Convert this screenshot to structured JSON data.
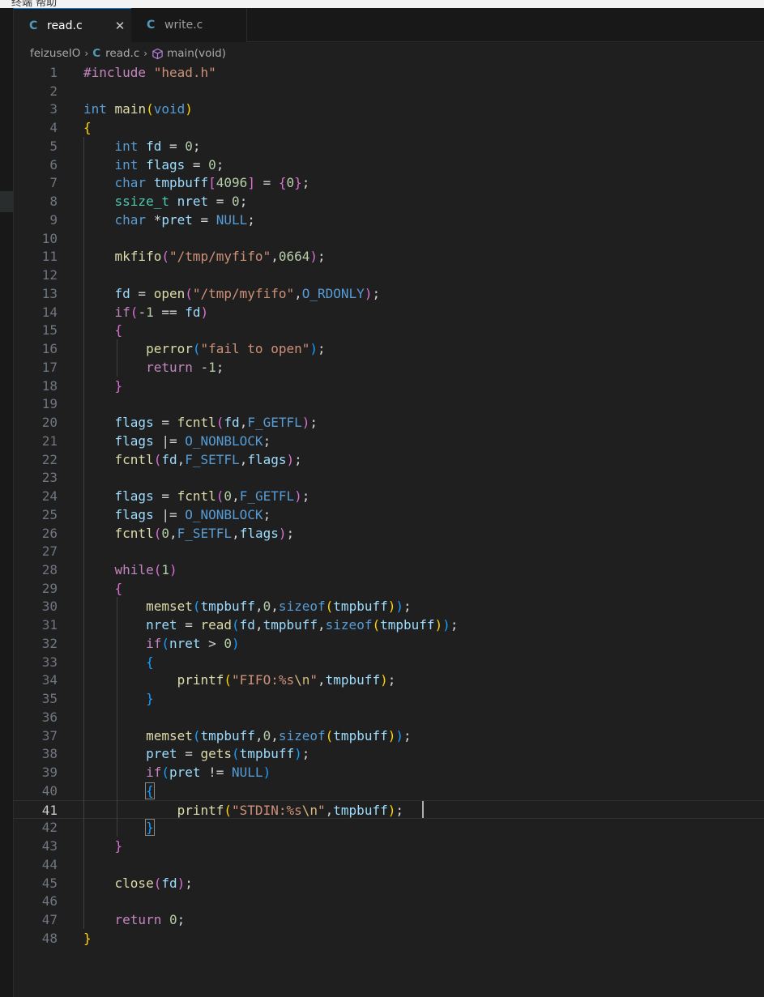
{
  "menubar": {
    "text": "终端  帮助"
  },
  "tabs": [
    {
      "icon": "C",
      "label": "read.c",
      "active": true,
      "close": "✕"
    },
    {
      "icon": "C",
      "label": "write.c",
      "active": false
    }
  ],
  "breadcrumb": {
    "folder": "feizuseIO",
    "file_icon": "C",
    "file": "read.c",
    "symbol": "main(void)"
  },
  "editor": {
    "current_line": 41,
    "lines": [
      {
        "n": "1",
        "tokens": [
          [
            "pre",
            "#include "
          ],
          [
            "str",
            "\"head.h\""
          ]
        ]
      },
      {
        "n": "2",
        "tokens": []
      },
      {
        "n": "3",
        "tokens": [
          [
            "kw",
            "int"
          ],
          [
            "op",
            " "
          ],
          [
            "fn",
            "main"
          ],
          [
            "b1",
            "("
          ],
          [
            "kw",
            "void"
          ],
          [
            "b1",
            ")"
          ]
        ]
      },
      {
        "n": "4",
        "tokens": [
          [
            "b1",
            "{"
          ]
        ]
      },
      {
        "n": "5",
        "tokens": [
          [
            "op",
            "    "
          ],
          [
            "kw",
            "int"
          ],
          [
            "op",
            " "
          ],
          [
            "var",
            "fd"
          ],
          [
            "op",
            " = "
          ],
          [
            "num",
            "0"
          ],
          [
            "op",
            ";"
          ]
        ]
      },
      {
        "n": "6",
        "tokens": [
          [
            "op",
            "    "
          ],
          [
            "kw",
            "int"
          ],
          [
            "op",
            " "
          ],
          [
            "var",
            "flags"
          ],
          [
            "op",
            " = "
          ],
          [
            "num",
            "0"
          ],
          [
            "op",
            ";"
          ]
        ]
      },
      {
        "n": "7",
        "tokens": [
          [
            "op",
            "    "
          ],
          [
            "kw",
            "char"
          ],
          [
            "op",
            " "
          ],
          [
            "var",
            "tmpbuff"
          ],
          [
            "b2",
            "["
          ],
          [
            "num",
            "4096"
          ],
          [
            "b2",
            "]"
          ],
          [
            "op",
            " = "
          ],
          [
            "b2",
            "{"
          ],
          [
            "num",
            "0"
          ],
          [
            "b2",
            "}"
          ],
          [
            "op",
            ";"
          ]
        ]
      },
      {
        "n": "8",
        "tokens": [
          [
            "op",
            "    "
          ],
          [
            "typ",
            "ssize_t"
          ],
          [
            "op",
            " "
          ],
          [
            "var",
            "nret"
          ],
          [
            "op",
            " = "
          ],
          [
            "num",
            "0"
          ],
          [
            "op",
            ";"
          ]
        ]
      },
      {
        "n": "9",
        "tokens": [
          [
            "op",
            "    "
          ],
          [
            "kw",
            "char"
          ],
          [
            "op",
            " *"
          ],
          [
            "var",
            "pret"
          ],
          [
            "op",
            " = "
          ],
          [
            "mac",
            "NULL"
          ],
          [
            "op",
            ";"
          ]
        ]
      },
      {
        "n": "10",
        "tokens": []
      },
      {
        "n": "11",
        "tokens": [
          [
            "op",
            "    "
          ],
          [
            "fn",
            "mkfifo"
          ],
          [
            "b2",
            "("
          ],
          [
            "str",
            "\"/tmp/myfifo\""
          ],
          [
            "op",
            ","
          ],
          [
            "num",
            "0664"
          ],
          [
            "b2",
            ")"
          ],
          [
            "op",
            ";"
          ]
        ]
      },
      {
        "n": "12",
        "tokens": []
      },
      {
        "n": "13",
        "tokens": [
          [
            "op",
            "    "
          ],
          [
            "var",
            "fd"
          ],
          [
            "op",
            " = "
          ],
          [
            "fn",
            "open"
          ],
          [
            "b2",
            "("
          ],
          [
            "str",
            "\"/tmp/myfifo\""
          ],
          [
            "op",
            ","
          ],
          [
            "mac",
            "O_RDONLY"
          ],
          [
            "b2",
            ")"
          ],
          [
            "op",
            ";"
          ]
        ]
      },
      {
        "n": "14",
        "tokens": [
          [
            "op",
            "    "
          ],
          [
            "ctl",
            "if"
          ],
          [
            "b2",
            "("
          ],
          [
            "op",
            "-"
          ],
          [
            "num",
            "1"
          ],
          [
            "op",
            " == "
          ],
          [
            "var",
            "fd"
          ],
          [
            "b2",
            ")"
          ]
        ]
      },
      {
        "n": "15",
        "tokens": [
          [
            "op",
            "    "
          ],
          [
            "b2",
            "{"
          ]
        ]
      },
      {
        "n": "16",
        "tokens": [
          [
            "op",
            "        "
          ],
          [
            "fn",
            "perror"
          ],
          [
            "b3",
            "("
          ],
          [
            "str",
            "\"fail to open\""
          ],
          [
            "b3",
            ")"
          ],
          [
            "op",
            ";"
          ]
        ]
      },
      {
        "n": "17",
        "tokens": [
          [
            "op",
            "        "
          ],
          [
            "ctl",
            "return"
          ],
          [
            "op",
            " -"
          ],
          [
            "num",
            "1"
          ],
          [
            "op",
            ";"
          ]
        ]
      },
      {
        "n": "18",
        "tokens": [
          [
            "op",
            "    "
          ],
          [
            "b2",
            "}"
          ]
        ]
      },
      {
        "n": "19",
        "tokens": []
      },
      {
        "n": "20",
        "tokens": [
          [
            "op",
            "    "
          ],
          [
            "var",
            "flags"
          ],
          [
            "op",
            " = "
          ],
          [
            "fn",
            "fcntl"
          ],
          [
            "b2",
            "("
          ],
          [
            "var",
            "fd"
          ],
          [
            "op",
            ","
          ],
          [
            "mac",
            "F_GETFL"
          ],
          [
            "b2",
            ")"
          ],
          [
            "op",
            ";"
          ]
        ]
      },
      {
        "n": "21",
        "tokens": [
          [
            "op",
            "    "
          ],
          [
            "var",
            "flags"
          ],
          [
            "op",
            " |= "
          ],
          [
            "mac",
            "O_NONBLOCK"
          ],
          [
            "op",
            ";"
          ]
        ]
      },
      {
        "n": "22",
        "tokens": [
          [
            "op",
            "    "
          ],
          [
            "fn",
            "fcntl"
          ],
          [
            "b2",
            "("
          ],
          [
            "var",
            "fd"
          ],
          [
            "op",
            ","
          ],
          [
            "mac",
            "F_SETFL"
          ],
          [
            "op",
            ","
          ],
          [
            "var",
            "flags"
          ],
          [
            "b2",
            ")"
          ],
          [
            "op",
            ";"
          ]
        ]
      },
      {
        "n": "23",
        "tokens": []
      },
      {
        "n": "24",
        "tokens": [
          [
            "op",
            "    "
          ],
          [
            "var",
            "flags"
          ],
          [
            "op",
            " = "
          ],
          [
            "fn",
            "fcntl"
          ],
          [
            "b2",
            "("
          ],
          [
            "num",
            "0"
          ],
          [
            "op",
            ","
          ],
          [
            "mac",
            "F_GETFL"
          ],
          [
            "b2",
            ")"
          ],
          [
            "op",
            ";"
          ]
        ]
      },
      {
        "n": "25",
        "tokens": [
          [
            "op",
            "    "
          ],
          [
            "var",
            "flags"
          ],
          [
            "op",
            " |= "
          ],
          [
            "mac",
            "O_NONBLOCK"
          ],
          [
            "op",
            ";"
          ]
        ]
      },
      {
        "n": "26",
        "tokens": [
          [
            "op",
            "    "
          ],
          [
            "fn",
            "fcntl"
          ],
          [
            "b2",
            "("
          ],
          [
            "num",
            "0"
          ],
          [
            "op",
            ","
          ],
          [
            "mac",
            "F_SETFL"
          ],
          [
            "op",
            ","
          ],
          [
            "var",
            "flags"
          ],
          [
            "b2",
            ")"
          ],
          [
            "op",
            ";"
          ]
        ]
      },
      {
        "n": "27",
        "tokens": []
      },
      {
        "n": "28",
        "tokens": [
          [
            "op",
            "    "
          ],
          [
            "ctl",
            "while"
          ],
          [
            "b2",
            "("
          ],
          [
            "num",
            "1"
          ],
          [
            "b2",
            ")"
          ]
        ]
      },
      {
        "n": "29",
        "tokens": [
          [
            "op",
            "    "
          ],
          [
            "b2",
            "{"
          ]
        ]
      },
      {
        "n": "30",
        "tokens": [
          [
            "op",
            "        "
          ],
          [
            "fn",
            "memset"
          ],
          [
            "b3",
            "("
          ],
          [
            "var",
            "tmpbuff"
          ],
          [
            "op",
            ","
          ],
          [
            "num",
            "0"
          ],
          [
            "op",
            ","
          ],
          [
            "kw",
            "sizeof"
          ],
          [
            "b1",
            "("
          ],
          [
            "var",
            "tmpbuff"
          ],
          [
            "b1",
            ")"
          ],
          [
            "b3",
            ")"
          ],
          [
            "op",
            ";"
          ]
        ]
      },
      {
        "n": "31",
        "tokens": [
          [
            "op",
            "        "
          ],
          [
            "var",
            "nret"
          ],
          [
            "op",
            " = "
          ],
          [
            "fn",
            "read"
          ],
          [
            "b3",
            "("
          ],
          [
            "var",
            "fd"
          ],
          [
            "op",
            ","
          ],
          [
            "var",
            "tmpbuff"
          ],
          [
            "op",
            ","
          ],
          [
            "kw",
            "sizeof"
          ],
          [
            "b1",
            "("
          ],
          [
            "var",
            "tmpbuff"
          ],
          [
            "b1",
            ")"
          ],
          [
            "b3",
            ")"
          ],
          [
            "op",
            ";"
          ]
        ]
      },
      {
        "n": "32",
        "tokens": [
          [
            "op",
            "        "
          ],
          [
            "ctl",
            "if"
          ],
          [
            "b3",
            "("
          ],
          [
            "var",
            "nret"
          ],
          [
            "op",
            " > "
          ],
          [
            "num",
            "0"
          ],
          [
            "b3",
            ")"
          ]
        ]
      },
      {
        "n": "33",
        "tokens": [
          [
            "op",
            "        "
          ],
          [
            "b3",
            "{"
          ]
        ]
      },
      {
        "n": "34",
        "tokens": [
          [
            "op",
            "            "
          ],
          [
            "fn",
            "printf"
          ],
          [
            "b1",
            "("
          ],
          [
            "str",
            "\"FIFO:%s"
          ],
          [
            "esc",
            "\\n"
          ],
          [
            "str",
            "\""
          ],
          [
            "op",
            ","
          ],
          [
            "var",
            "tmpbuff"
          ],
          [
            "b1",
            ")"
          ],
          [
            "op",
            ";"
          ]
        ]
      },
      {
        "n": "35",
        "tokens": [
          [
            "op",
            "        "
          ],
          [
            "b3",
            "}"
          ]
        ]
      },
      {
        "n": "36",
        "tokens": []
      },
      {
        "n": "37",
        "tokens": [
          [
            "op",
            "        "
          ],
          [
            "fn",
            "memset"
          ],
          [
            "b3",
            "("
          ],
          [
            "var",
            "tmpbuff"
          ],
          [
            "op",
            ","
          ],
          [
            "num",
            "0"
          ],
          [
            "op",
            ","
          ],
          [
            "kw",
            "sizeof"
          ],
          [
            "b1",
            "("
          ],
          [
            "var",
            "tmpbuff"
          ],
          [
            "b1",
            ")"
          ],
          [
            "b3",
            ")"
          ],
          [
            "op",
            ";"
          ]
        ]
      },
      {
        "n": "38",
        "tokens": [
          [
            "op",
            "        "
          ],
          [
            "var",
            "pret"
          ],
          [
            "op",
            " = "
          ],
          [
            "fn",
            "gets"
          ],
          [
            "b3",
            "("
          ],
          [
            "var",
            "tmpbuff"
          ],
          [
            "b3",
            ")"
          ],
          [
            "op",
            ";"
          ]
        ]
      },
      {
        "n": "39",
        "tokens": [
          [
            "op",
            "        "
          ],
          [
            "ctl",
            "if"
          ],
          [
            "b3",
            "("
          ],
          [
            "var",
            "pret"
          ],
          [
            "op",
            " != "
          ],
          [
            "mac",
            "NULL"
          ],
          [
            "b3",
            ")"
          ]
        ]
      },
      {
        "n": "40",
        "tokens": [
          [
            "op",
            "        "
          ],
          [
            "b3m",
            "{"
          ]
        ]
      },
      {
        "n": "41",
        "tokens": [
          [
            "op",
            "            "
          ],
          [
            "fn",
            "printf"
          ],
          [
            "b1",
            "("
          ],
          [
            "str",
            "\"STDIN:%s"
          ],
          [
            "esc",
            "\\n"
          ],
          [
            "str",
            "\""
          ],
          [
            "op",
            ","
          ],
          [
            "var",
            "tmpbuff"
          ],
          [
            "b1",
            ")"
          ],
          [
            "op",
            ";"
          ]
        ]
      },
      {
        "n": "42",
        "tokens": [
          [
            "op",
            "        "
          ],
          [
            "b3m",
            "}"
          ]
        ]
      },
      {
        "n": "43",
        "tokens": [
          [
            "op",
            "    "
          ],
          [
            "b2",
            "}"
          ]
        ]
      },
      {
        "n": "44",
        "tokens": []
      },
      {
        "n": "45",
        "tokens": [
          [
            "op",
            "    "
          ],
          [
            "fn",
            "close"
          ],
          [
            "b2",
            "("
          ],
          [
            "var",
            "fd"
          ],
          [
            "b2",
            ")"
          ],
          [
            "op",
            ";"
          ]
        ]
      },
      {
        "n": "46",
        "tokens": []
      },
      {
        "n": "47",
        "tokens": [
          [
            "op",
            "    "
          ],
          [
            "ctl",
            "return"
          ],
          [
            "op",
            " "
          ],
          [
            "num",
            "0"
          ],
          [
            "op",
            ";"
          ]
        ]
      },
      {
        "n": "48",
        "tokens": [
          [
            "b1",
            "}"
          ]
        ]
      }
    ]
  }
}
